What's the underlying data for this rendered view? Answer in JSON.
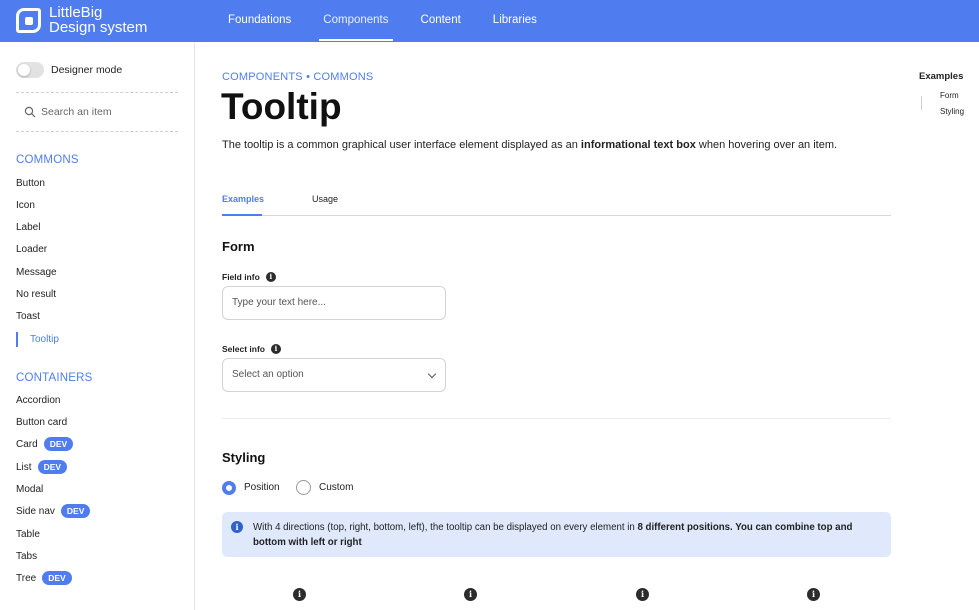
{
  "header": {
    "logo_line1": "LittleBig",
    "logo_line2": "Design system",
    "nav": [
      "Foundations",
      "Components",
      "Content",
      "Libraries"
    ],
    "active_nav": "Components",
    "accent_color": "#4f7df0"
  },
  "sidebar": {
    "toggle_label": "Designer mode",
    "search_placeholder": "Search an item",
    "commons_title": "COMMONS",
    "commons_items": [
      "Button",
      "Icon",
      "Label",
      "Loader",
      "Message",
      "No result",
      "Toast",
      "Tooltip"
    ],
    "active_item": "Tooltip",
    "containers_title": "CONTAINERS",
    "containers_items": [
      {
        "label": "Accordion",
        "badge": ""
      },
      {
        "label": "Button card",
        "badge": ""
      },
      {
        "label": "Card",
        "badge": "DEV"
      },
      {
        "label": "List",
        "badge": "DEV"
      },
      {
        "label": "Modal",
        "badge": ""
      },
      {
        "label": "Side nav",
        "badge": "DEV"
      },
      {
        "label": "Table",
        "badge": ""
      },
      {
        "label": "Tabs",
        "badge": ""
      },
      {
        "label": "Tree",
        "badge": "DEV"
      }
    ]
  },
  "main": {
    "breadcrumb": "COMPONENTS • COMMONS",
    "title": "Tooltip",
    "intro_before": "The tooltip is a common graphical user interface element displayed as an ",
    "intro_bold": "informational text box",
    "intro_after": " when hovering over an item.",
    "tabs": [
      "Examples",
      "Usage"
    ],
    "form_title": "Form",
    "field_info_label": "Field info",
    "field_info_placeholder": "Type your text here...",
    "select_info_label": "Select info",
    "select_placeholder": "Select an option",
    "styling_title": "Styling",
    "radio_position": "Position",
    "radio_custom": "Custom",
    "notice_before": "With 4 directions (top, right, bottom, left), the tooltip can be displayed on every element in ",
    "notice_bold": "8 different positions. You can combine top and bottom with left or right"
  },
  "toc": {
    "title": "Examples",
    "items": [
      "Form",
      "Styling"
    ]
  }
}
